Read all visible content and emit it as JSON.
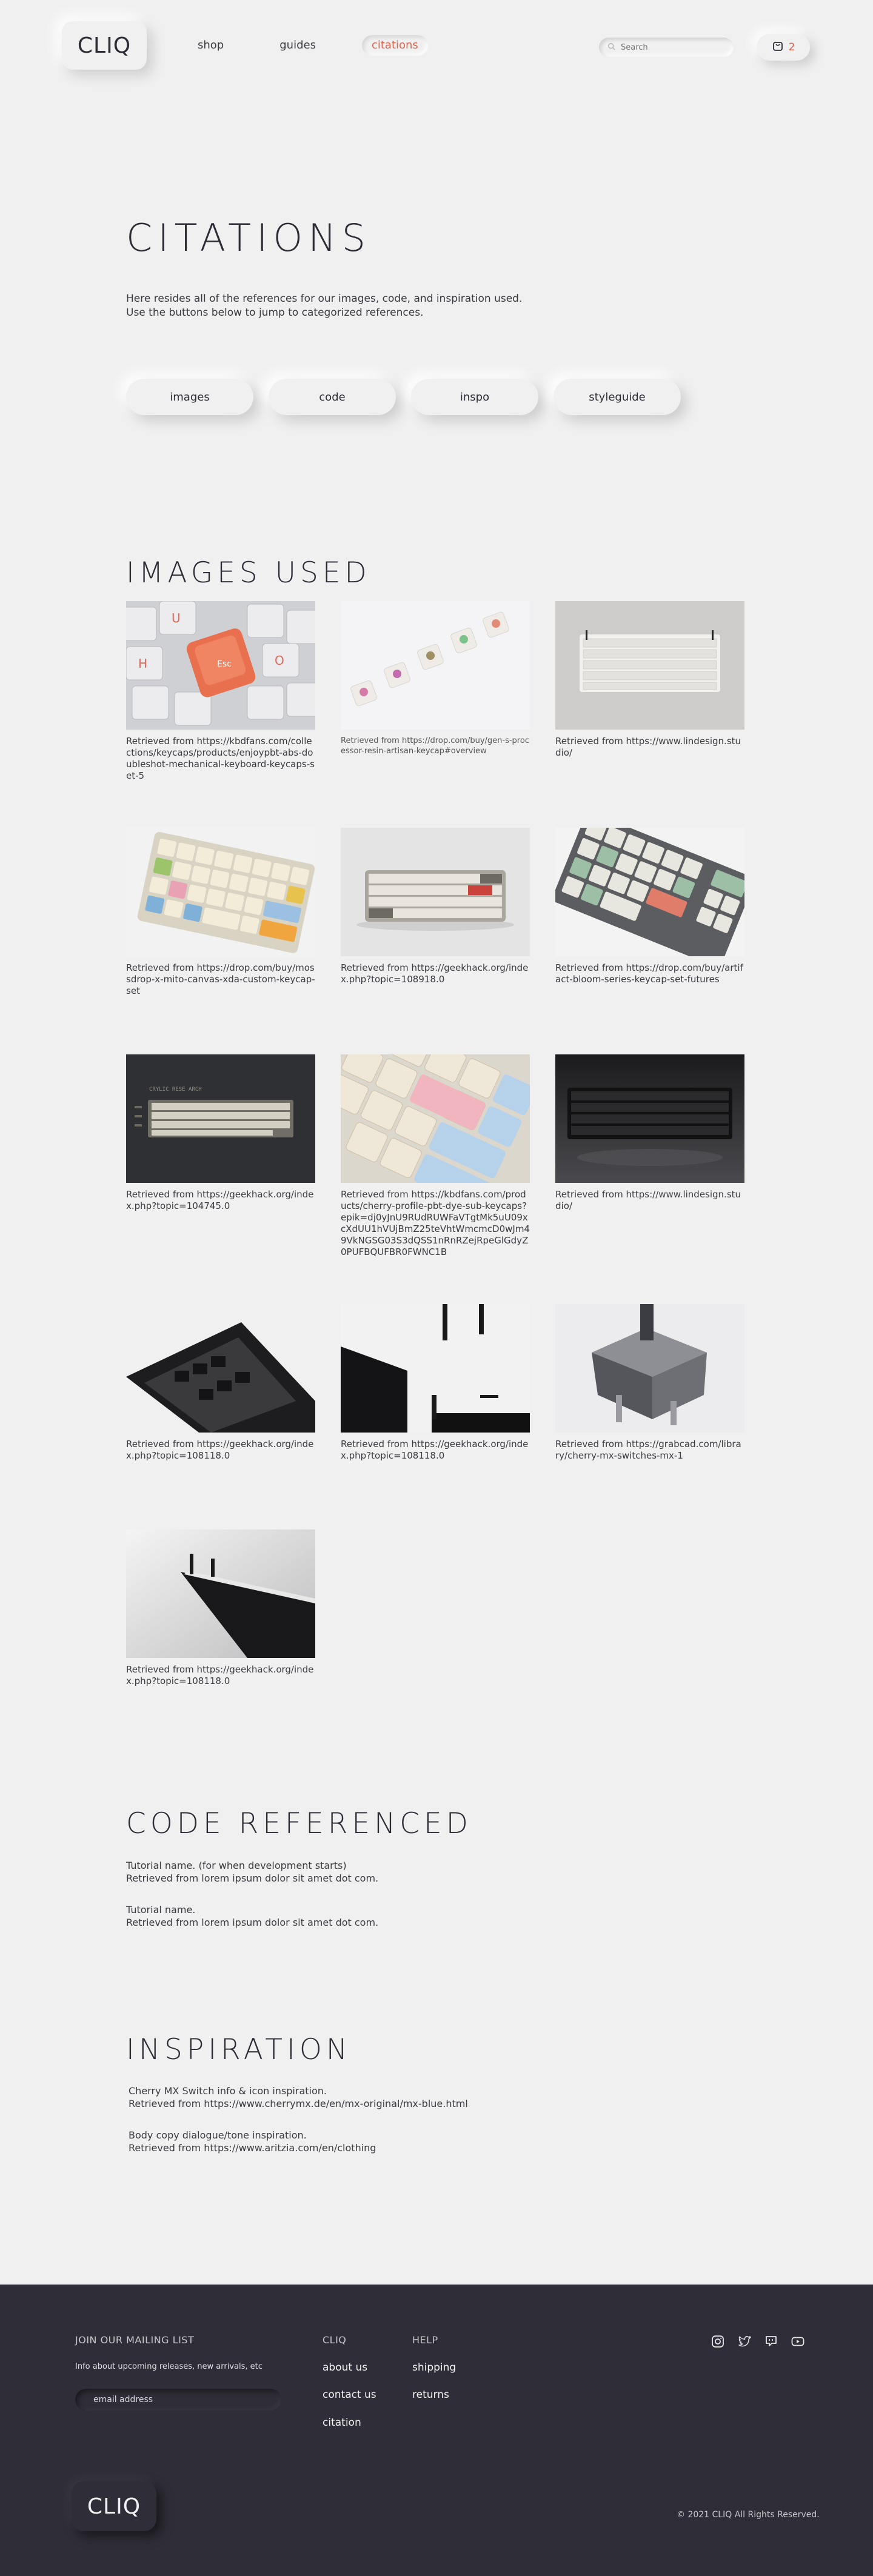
{
  "header": {
    "logo": "CLIQ",
    "nav": [
      "shop",
      "guides",
      "citations"
    ],
    "search_placeholder": "Search",
    "cart_count": "2"
  },
  "intro": {
    "title": "CITATIONS",
    "line1": "Here resides all of the references for our images, code, and inspiration used.",
    "line2": "Use the buttons below to jump to categorized references.",
    "buttons": [
      "images",
      "code",
      "inspo",
      "styleguide"
    ]
  },
  "images_section": {
    "title": "IMAGES USED",
    "items": [
      {
        "caption": "Retrieved from https://kbdfans.com/collections/keycaps/products/enjoypbt-abs-doubleshot-mechanical-keyboard-keycaps-set-5"
      },
      {
        "caption": "Retrieved from https://drop.com/buy/gen-s-processor-resin-artisan-keycap#overview"
      },
      {
        "caption": "Retrieved from https://www.lindesign.studio/"
      },
      {
        "caption": "Retrieved from https://drop.com/buy/mossdrop-x-mito-canvas-xda-custom-keycap-set"
      },
      {
        "caption": "Retrieved from https://geekhack.org/index.php?topic=108918.0"
      },
      {
        "caption": "Retrieved from https://drop.com/buy/artifact-bloom-series-keycap-set-futures"
      },
      {
        "caption": "Retrieved from https://geekhack.org/index.php?topic=104745.0"
      },
      {
        "caption": "Retrieved from https://kbdfans.com/products/cherry-profile-pbt-dye-sub-keycaps?epik=dj0yJnU9RUdRUWFaVTgtMk5uU09xcXdUU1hVUjBmZ25teVhtWmcmcD0wJm49VkNGSG03S3dQSS1nRnRZejRpeGlGdyZ0PUFBQUFBR0FWNC1B"
      },
      {
        "caption": "Retrieved from https://www.lindesign.studio/"
      },
      {
        "caption": "Retrieved from https://geekhack.org/index.php?topic=108118.0"
      },
      {
        "caption": "Retrieved from https://geekhack.org/index.php?topic=108118.0"
      },
      {
        "caption": "Retrieved from https://grabcad.com/library/cherry-mx-switches-mx-1"
      },
      {
        "caption": "Retrieved from https://geekhack.org/index.php?topic=108118.0"
      }
    ]
  },
  "code_section": {
    "title": "CODE REFERENCED",
    "entries": [
      {
        "name": "Tutorial name. (for when development starts)",
        "source": "Retrieved from lorem ipsum dolor sit amet dot com."
      },
      {
        "name": "Tutorial name.",
        "source": "Retrieved from lorem ipsum dolor sit amet dot com."
      }
    ]
  },
  "inspiration_section": {
    "title": "INSPIRATION",
    "entries": [
      {
        "name": "Cherry MX Switch info & icon inspiration.",
        "source": "Retrieved from https://www.cherrymx.de/en/mx-original/mx-blue.html"
      },
      {
        "name": "Body copy dialogue/tone inspiration.",
        "source": "Retrieved from https://www.aritzia.com/en/clothing"
      }
    ]
  },
  "footer": {
    "mailing_heading": "JOIN OUR MAILING LIST",
    "mailing_text": "Info about upcoming releases, new arrivals, etc",
    "email_placeholder": "email address",
    "cliq_heading": "CLIQ",
    "cliq_links": [
      "about us",
      "contact us",
      "citation"
    ],
    "help_heading": "HELP",
    "help_links": [
      "shipping",
      "returns"
    ],
    "social_icons": [
      "instagram-icon",
      "twitter-icon",
      "chat-icon",
      "youtube-icon"
    ],
    "logo": "CLIQ",
    "copyright": "© 2021 CLIQ All Rights Reserved."
  }
}
